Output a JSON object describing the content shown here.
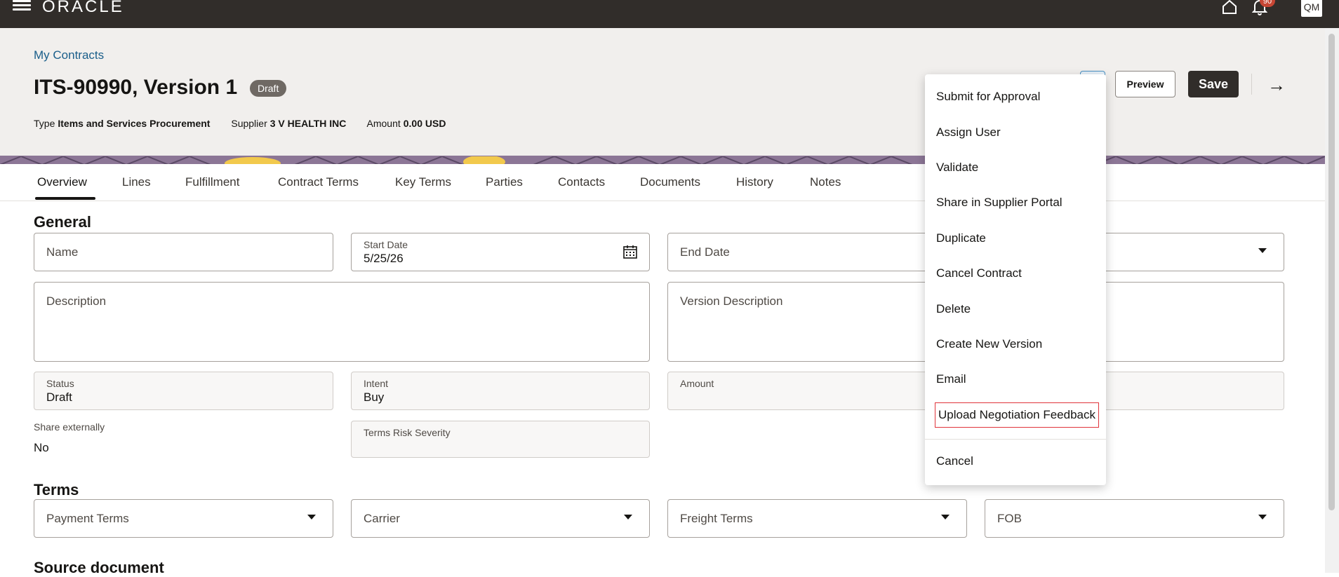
{
  "topbar": {
    "logo": "ORACLE",
    "notification_count": "90",
    "avatar_initials": "QM"
  },
  "header": {
    "breadcrumb": "My Contracts",
    "title": "ITS-90990, Version 1",
    "status": "Draft",
    "meta": [
      {
        "label": "Type",
        "value": "Items and Services Procurement"
      },
      {
        "label": "Supplier",
        "value": "3 V HEALTH INC"
      },
      {
        "label": "Amount",
        "value": "0.00 USD"
      }
    ],
    "preview_label": "Preview",
    "save_label": "Save"
  },
  "tabs": [
    {
      "label": "Overview",
      "active": true
    },
    {
      "label": "Lines"
    },
    {
      "label": "Fulfillment"
    },
    {
      "label": "Contract Terms"
    },
    {
      "label": "Key Terms"
    },
    {
      "label": "Parties"
    },
    {
      "label": "Contacts"
    },
    {
      "label": "Documents"
    },
    {
      "label": "History"
    },
    {
      "label": "Notes"
    }
  ],
  "general": {
    "title": "General",
    "name_placeholder": "Name",
    "start_date_label": "Start Date",
    "start_date_value": "5/25/26",
    "end_date_placeholder": "End Date",
    "description_placeholder": "Description",
    "version_description_placeholder": "Version Description",
    "status_label": "Status",
    "status_value": "Draft",
    "intent_label": "Intent",
    "intent_value": "Buy",
    "amount_label": "Amount",
    "share_label": "Share externally",
    "share_value": "No",
    "terms_risk_label": "Terms Risk Severity"
  },
  "terms": {
    "title": "Terms",
    "payment_terms": "Payment Terms",
    "carrier": "Carrier",
    "freight_terms": "Freight Terms",
    "fob": "FOB"
  },
  "source_document": {
    "title": "Source document"
  },
  "menu": {
    "items": [
      "Submit for Approval",
      "Assign User",
      "Validate",
      "Share in Supplier Portal",
      "Duplicate",
      "Cancel Contract",
      "Delete",
      "Create New Version",
      "Email",
      "Upload Negotiation Feedback"
    ],
    "cancel": "Cancel"
  },
  "colors": {
    "topbar": "#312d2a",
    "header_bg": "#f1efed",
    "link": "#1a5e8a",
    "highlight_border": "#e0343b"
  }
}
